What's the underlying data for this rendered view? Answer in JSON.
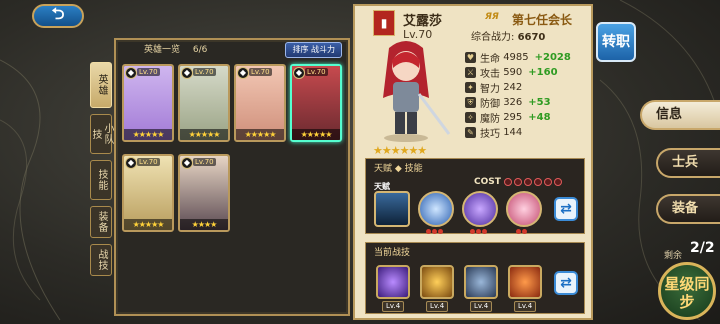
{
  "back_button": {
    "icon": "back-arrow-icon"
  },
  "side_tabs": [
    {
      "label": "英雄",
      "active": true
    },
    {
      "label": "小队技",
      "active": false
    },
    {
      "label": "技能",
      "active": false
    },
    {
      "label": "装备",
      "active": false
    },
    {
      "label": "战技",
      "active": false
    }
  ],
  "hero_list": {
    "title": "英雄一览",
    "count": "6/6",
    "sort_button": "排序 战斗力",
    "heroes": [
      {
        "level": "Lv.70",
        "stars": "★★★★★",
        "selected": false,
        "colors": [
          "#cfb6ef",
          "#a27ad6"
        ]
      },
      {
        "level": "Lv.70",
        "stars": "★★★★★",
        "selected": false,
        "colors": [
          "#d6dac9",
          "#9aa385"
        ]
      },
      {
        "level": "Lv.70",
        "stars": "★★★★★",
        "selected": false,
        "colors": [
          "#f2c7b4",
          "#cf8f7a"
        ]
      },
      {
        "level": "Lv.70",
        "stars": "★★★★★",
        "selected": true,
        "colors": [
          "#c74a4e",
          "#6a2a30"
        ]
      },
      {
        "level": "Lv.70",
        "stars": "★★★★★",
        "selected": false,
        "colors": [
          "#efe2b3",
          "#b89d5d"
        ]
      },
      {
        "level": "Lv.70",
        "stars": "★★★★",
        "selected": false,
        "colors": [
          "#e7d5c4",
          "#5b4a52"
        ]
      }
    ]
  },
  "detail": {
    "badge_icon": "red-rank-icon",
    "name": "艾露莎",
    "level": "Lv.70",
    "title_badge": "ЯЯ",
    "title": "第七任会长",
    "power_label": "综合战力:",
    "power_value": "6670",
    "stars": "★★★★★★",
    "stats": [
      {
        "label": "生命",
        "value": "4985",
        "bonus": "+2028"
      },
      {
        "label": "攻击",
        "value": "590",
        "bonus": "+160"
      },
      {
        "label": "智力",
        "value": "242",
        "bonus": ""
      },
      {
        "label": "防御",
        "value": "326",
        "bonus": "+53"
      },
      {
        "label": "魔防",
        "value": "295",
        "bonus": "+48"
      },
      {
        "label": "技巧",
        "value": "144",
        "bonus": ""
      }
    ],
    "talent_section": "天赋 ◆ 技能",
    "talent_label": "天赋",
    "cost_label": "COST",
    "current_section": "当前战技",
    "skills": [
      {
        "level": "Lv.4"
      },
      {
        "level": "Lv.4"
      },
      {
        "level": "Lv.4"
      },
      {
        "level": "Lv.4"
      }
    ]
  },
  "right_buttons": {
    "transfer": "转职",
    "info": "信息",
    "soldier": "士兵",
    "equip": "装备",
    "remain_label": "剩余",
    "remain_value": "2/2",
    "star_sync": "星级同步"
  },
  "colors": {
    "accent_gold": "#b99a5d",
    "panel_cream": "#efe3c3",
    "bonus_green": "#2f9b22"
  }
}
